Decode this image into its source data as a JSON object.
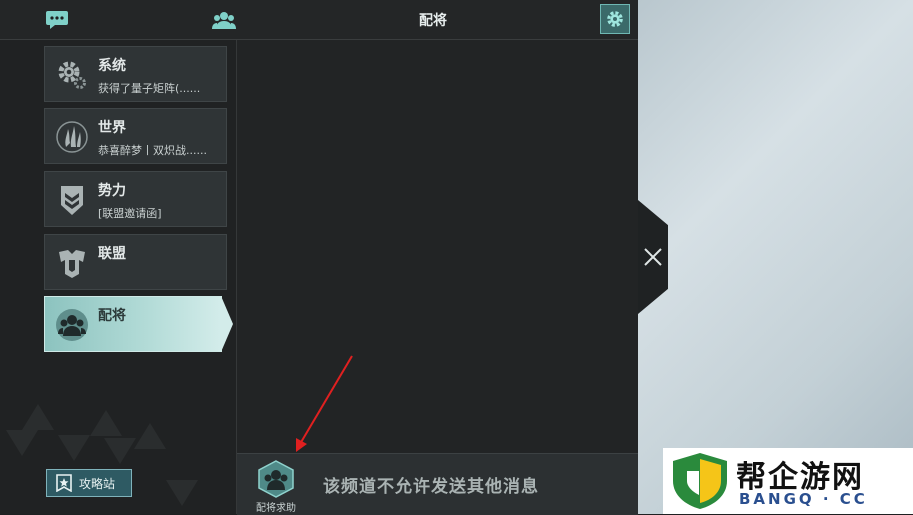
{
  "header": {
    "title": "配将",
    "icons": [
      "chat-icon",
      "group-icon",
      "gear-icon"
    ]
  },
  "channels": [
    {
      "name": "系统",
      "preview": "获得了量子矩阵(......",
      "icon": "gear-cluster-icon"
    },
    {
      "name": "世界",
      "preview": "恭喜醉梦丨双炽战......",
      "icon": "flame-emblem-icon"
    },
    {
      "name": "势力",
      "preview": "[联盟邀请函]",
      "icon": "chevron-shield-icon"
    },
    {
      "name": "联盟",
      "preview": "",
      "icon": "alliance-emblem-icon"
    },
    {
      "name": "配将",
      "preview": "",
      "icon": "generals-group-icon",
      "active": true
    }
  ],
  "sidebar": {
    "guide_label": "攻略站"
  },
  "bottom": {
    "help_label": "配将求助",
    "notice": "该频道不允许发送其他消息"
  },
  "watermark": {
    "text": "帮企游网",
    "sub": "BANGQ · CC"
  },
  "colors": {
    "accent": "#8cc3bf",
    "panel": "#2f3436",
    "background": "#1e2021",
    "annotation_arrow": "#e02020"
  }
}
